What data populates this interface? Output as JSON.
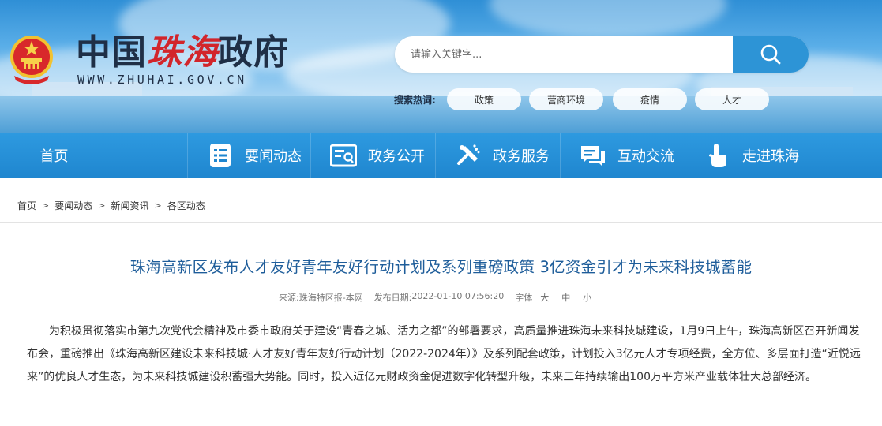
{
  "site": {
    "logo_prefix": "中国",
    "logo_calligraphy": "珠海",
    "logo_suffix": "政府",
    "url": "WWW.ZHUHAI.GOV.CN"
  },
  "search": {
    "placeholder": "请输入关键字..."
  },
  "hot_search": {
    "label": "搜索热词:",
    "tags": [
      "政策",
      "营商环境",
      "疫情",
      "人才"
    ]
  },
  "nav": {
    "items": [
      {
        "label": "首页",
        "icon": "none"
      },
      {
        "label": "要闻动态",
        "icon": "news-list-icon"
      },
      {
        "label": "政务公开",
        "icon": "document-icon"
      },
      {
        "label": "政务服务",
        "icon": "tools-icon"
      },
      {
        "label": "互动交流",
        "icon": "chat-icon"
      },
      {
        "label": "走进珠海",
        "icon": "hand-pointer-icon"
      }
    ]
  },
  "breadcrumb": [
    "首页",
    "要闻动态",
    "新闻资讯",
    "各区动态"
  ],
  "article": {
    "title": "珠海高新区发布人才友好青年友好行动计划及系列重磅政策 3亿资金引才为未来科技城蓄能",
    "source_label": "来源:",
    "source": "珠海特区报-本网",
    "date_label": "发布日期:",
    "date": "2022-01-10 07:56:20",
    "font_label": "字体",
    "font_sizes": [
      "大",
      "中",
      "小"
    ],
    "body": "为积极贯彻落实市第九次党代会精神及市委市政府关于建设“青春之城、活力之都”的部署要求，高质量推进珠海未来科技城建设，1月9日上午，珠海高新区召开新闻发布会，重磅推出《珠海高新区建设未来科技城·人才友好青年友好行动计划（2022-2024年）》及系列配套政策，计划投入3亿元人才专项经费，全方位、多层面打造“近悦远来”的优良人才生态，为未来科技城建设积蓄强大势能。同时，投入近亿元财政资金促进数字化转型升级，未来三年持续输出100万平方米产业载体壮大总部经济。"
  },
  "colors": {
    "nav_blue": "#1f86cf",
    "title_blue": "#1e5d9a",
    "logo_red": "#d2252b",
    "search_button": "#2d94d6"
  }
}
